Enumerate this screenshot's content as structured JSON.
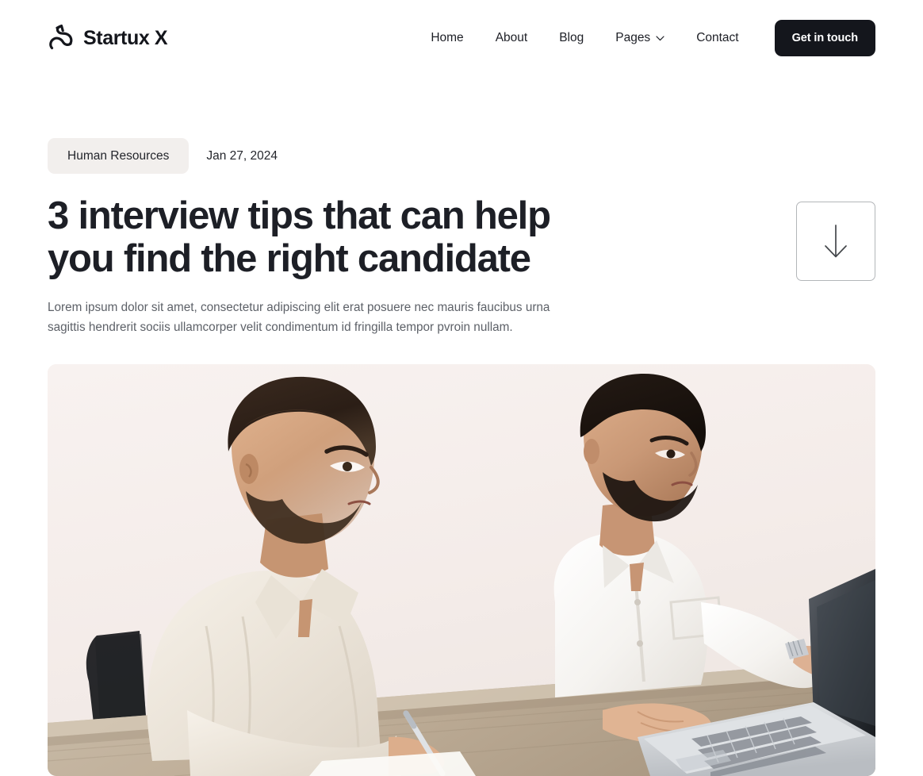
{
  "header": {
    "brand": {
      "name": "Startux X",
      "logo_icon": "swoosh-arrow-logo"
    },
    "nav": [
      {
        "label": "Home",
        "has_dropdown": false
      },
      {
        "label": "About",
        "has_dropdown": false
      },
      {
        "label": "Blog",
        "has_dropdown": false
      },
      {
        "label": "Pages",
        "has_dropdown": true,
        "icon": "chevron-down-icon"
      },
      {
        "label": "Contact",
        "has_dropdown": false
      }
    ],
    "cta": {
      "label": "Get in touch",
      "bg_color": "#14161c",
      "text_color": "#ffffff"
    }
  },
  "article": {
    "category": "Human Resources",
    "date": "Jan 27, 2024",
    "title": "3 interview tips that can help you find the right candidate",
    "lede": "Lorem ipsum dolor sit amet, consectetur adipiscing elit erat posuere nec mauris faucibus urna sagittis hendrerit sociis ullamcorper velit condimentum id fringilla tempor pvroin nullam.",
    "scroll_button_icon": "arrow-down-icon",
    "hero_image_alt": "Two men in white shirts seated at a wooden desk looking at a silver laptop"
  },
  "colors": {
    "page_bg": "#ffffff",
    "text_primary": "#1d1f26",
    "text_secondary": "#5d6168",
    "badge_bg": "#f2efed",
    "button_dark": "#14161c",
    "border_light": "#b3b6b9",
    "hero_bg": "#f6efec"
  }
}
